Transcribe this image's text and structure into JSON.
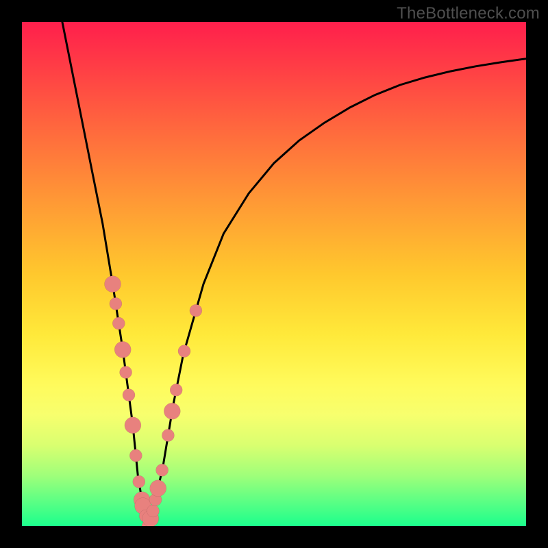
{
  "watermark": "TheBottleneck.com",
  "colors": {
    "frame": "#000000",
    "gradient_top": "#ff1f4c",
    "gradient_mid": "#ffe93a",
    "gradient_bottom": "#1cff8c",
    "curve": "#000000",
    "beads": "#e8817e"
  },
  "chart_data": {
    "type": "line",
    "title": "",
    "xlabel": "",
    "ylabel": "",
    "xlim": [
      0,
      100
    ],
    "ylim": [
      0,
      100
    ],
    "grid": false,
    "series": [
      {
        "name": "bottleneck-curve",
        "x": [
          8,
          10,
          12,
          14,
          16,
          18,
          20,
          22,
          23,
          24,
          25,
          26,
          28,
          30,
          32,
          36,
          40,
          45,
          50,
          55,
          60,
          65,
          70,
          75,
          80,
          85,
          90,
          95,
          100
        ],
        "y": [
          100,
          90,
          80,
          70,
          60,
          48,
          35,
          20,
          10,
          4,
          0,
          3,
          12,
          24,
          34,
          48,
          58,
          66,
          72,
          76.5,
          80,
          83,
          85.5,
          87.5,
          89,
          90.2,
          91.2,
          92,
          92.7
        ]
      }
    ],
    "markers": [
      {
        "name": "bead-cluster-left",
        "x": [
          18,
          18.6,
          19.2,
          20,
          20.6,
          21.2,
          22,
          22.6,
          23.2,
          23.8
        ],
        "note": "pink beads along descending arm"
      },
      {
        "name": "bead-cluster-bottom",
        "x": [
          24,
          24.5,
          25,
          25.5,
          26,
          26.5
        ],
        "note": "pink beads at valley"
      },
      {
        "name": "bead-cluster-right",
        "x": [
          27,
          27.8,
          29,
          29.8,
          30.6,
          32.2
        ],
        "note": "pink beads along ascending arm"
      },
      {
        "name": "bead-outlier",
        "x": [
          34.5
        ],
        "note": "isolated bead higher on right arm"
      }
    ],
    "annotations": []
  }
}
